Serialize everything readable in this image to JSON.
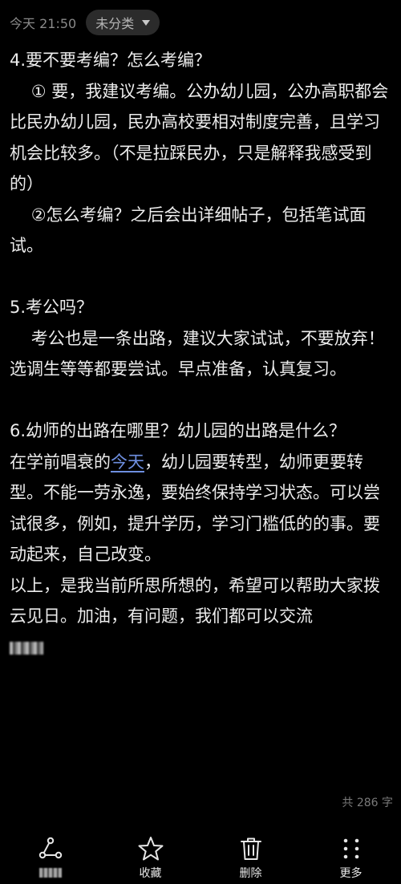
{
  "header": {
    "timestamp": "今天 21:50",
    "category": "未分类"
  },
  "note": {
    "section4_title": "4.要不要考编？怎么考编？",
    "section4_p1": "    ① 要，我建议考编。公办幼儿园，公办高职都会比民办幼儿园，民办高校要相对制度完善，且学习机会比较多。（不是拉踩民办，只是解释我感受到的）",
    "section4_p2": "    ②怎么考编？之后会出详细帖子，包括笔试面试。",
    "section5_title": "5.考公吗？",
    "section5_p1": "    考公也是一条出路，建议大家试试，不要放弃！选调生等等都要尝试。早点准备，认真复习。",
    "section6_title": "6.幼师的出路在哪里？幼儿园的出路是什么？",
    "section6_p1_before": "在学前唱衰的",
    "section6_p1_link": "今天",
    "section6_p1_after": "，幼儿园要转型，幼师更要转型。不能一劳永逸，要始终保持学习状态。可以尝试很多，例如，提升学历，学习门槛低的的事。要动起来，自己改变。",
    "closing": "以上，是我当前所思所想的，希望可以帮助大家拨云见日。加油，有问题，我们都可以交流"
  },
  "footer": {
    "word_count": "共 286 字"
  },
  "bottom_bar": {
    "favorite_label": "收藏",
    "delete_label": "删除",
    "more_label": "更多"
  }
}
